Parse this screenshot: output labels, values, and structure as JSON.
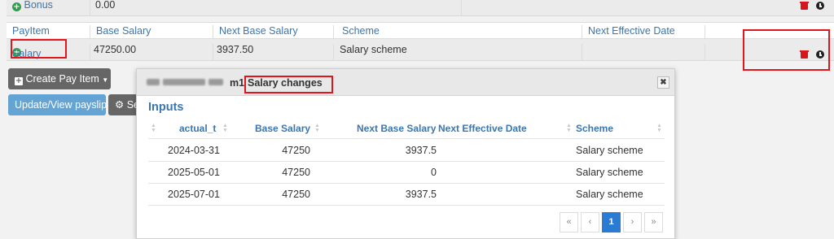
{
  "bonus_row": {
    "label": "Bonus",
    "value": "0.00"
  },
  "table_header": {
    "payitem": "PayItem",
    "base_salary": "Base Salary",
    "next_base_salary": "Next Base Salary",
    "scheme": "Scheme",
    "next_effective_date": "Next Effective Date"
  },
  "salary_row": {
    "label": "Salary",
    "base_salary": "47250.00",
    "next_base_salary": "3937.50",
    "scheme": "Salary scheme",
    "next_effective_date": ""
  },
  "buttons": {
    "create_pay_item": "Create Pay Item",
    "update_payslip": "Update/View payslip",
    "settings_partial": "Se"
  },
  "modal": {
    "title_prefix": "m1",
    "title": "Salary changes",
    "close": "✖",
    "section_title": "Inputs",
    "columns": {
      "actual_t": "actual_t",
      "base_salary": "Base Salary",
      "next_base_salary": "Next Base Salary",
      "next_effective_date": "Next Effective Date",
      "scheme": "Scheme"
    },
    "rows": [
      {
        "actual_t": "2024-03-31",
        "base_salary": "47250",
        "next_base_salary": "3937.5",
        "next_effective_date": "",
        "scheme": "Salary scheme"
      },
      {
        "actual_t": "2025-05-01",
        "base_salary": "47250",
        "next_base_salary": "0",
        "next_effective_date": "",
        "scheme": "Salary scheme"
      },
      {
        "actual_t": "2025-07-01",
        "base_salary": "47250",
        "next_base_salary": "3937.5",
        "next_effective_date": "",
        "scheme": "Salary scheme"
      }
    ],
    "pager": {
      "first": "«",
      "prev": "‹",
      "current": "1",
      "next": "›",
      "last": "»"
    }
  },
  "colors": {
    "link": "#3a76b0",
    "danger": "#d9141c",
    "highlight_box": "#e0161c",
    "pager_active": "#2a7bd4",
    "add_icon": "#2ea04a"
  },
  "icons": [
    "plus-circle-icon",
    "trash-icon",
    "clock-icon",
    "caret-down-icon",
    "gear-icon",
    "sort-icon",
    "close-icon"
  ]
}
